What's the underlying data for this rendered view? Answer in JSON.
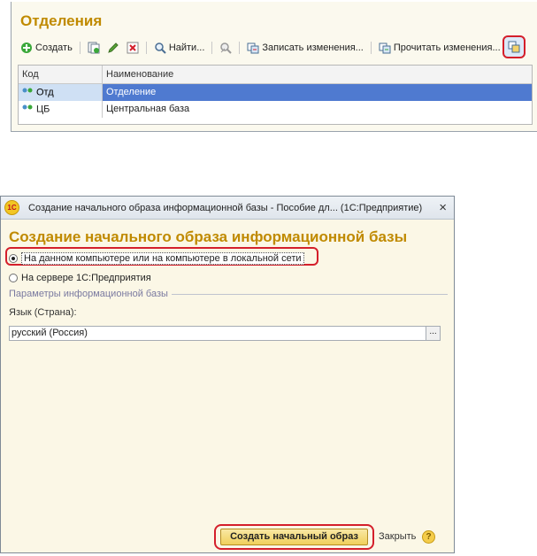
{
  "top_panel": {
    "title": "Отделения",
    "toolbar": {
      "create_label": "Создать",
      "find_label": "Найти...",
      "write_changes_label": "Записать изменения...",
      "read_changes_label": "Прочитать изменения..."
    },
    "grid": {
      "columns": [
        "Код",
        "Наименование"
      ],
      "rows": [
        {
          "code": "Отд",
          "name": "Отделение",
          "selected": true
        },
        {
          "code": "ЦБ",
          "name": "Центральная база",
          "selected": false
        }
      ]
    }
  },
  "dialog": {
    "logo_text": "1С",
    "title": "Создание начального образа информационной базы - Пособие дл...  (1С:Предприятие)",
    "heading": "Создание начального образа информационной базы",
    "radio_local": "На данном компьютере или на компьютере в локальной сети",
    "radio_server": "На сервере 1С:Предприятия",
    "radio_selected": "local",
    "params_group": "Параметры информационной базы",
    "lang_label": "Язык (Страна):",
    "lang_value": "русский (Россия)",
    "lang_button": "...",
    "create_button": "Создать начальный образ",
    "close_button": "Закрыть",
    "help_button": "?",
    "close_icon": "×"
  },
  "colors": {
    "title_orange": "#c08a00",
    "highlight_red": "#d41f2b",
    "selection_blue": "#4f7ad0"
  },
  "icons": [
    "add-icon",
    "copy-icon",
    "edit-icon",
    "delete-icon",
    "search-icon",
    "clear-filter-icon",
    "write-changes-icon",
    "read-changes-icon",
    "exchange-icon",
    "node-icon",
    "help-icon",
    "close-icon"
  ]
}
